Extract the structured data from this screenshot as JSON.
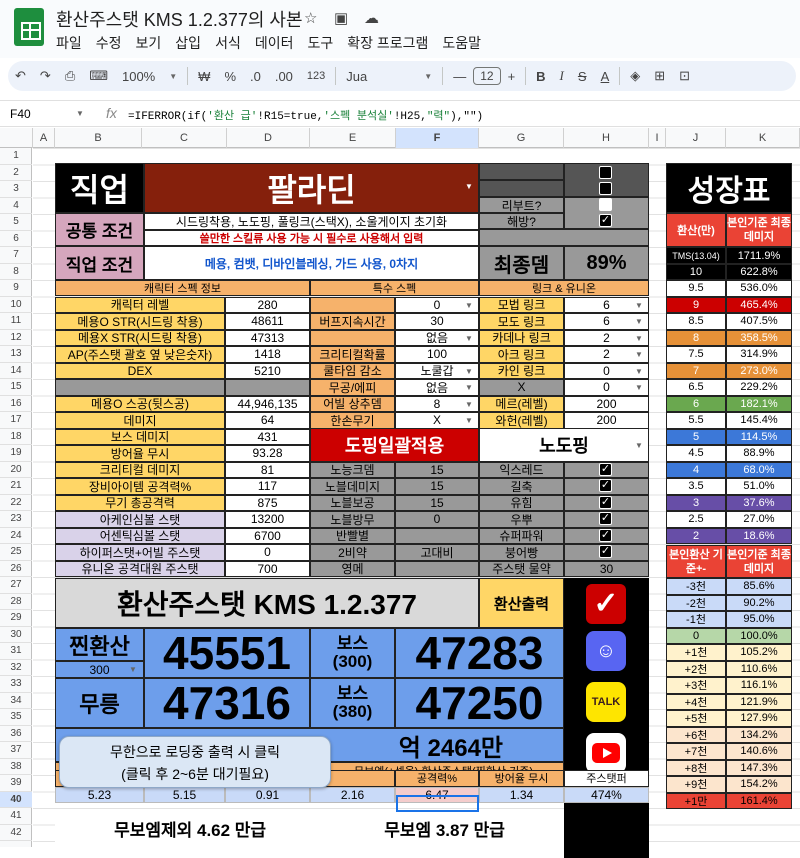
{
  "app": {
    "doc_title": "환산주스탯 KMS 1.2.377의 사본",
    "menu": [
      "파일",
      "수정",
      "보기",
      "삽입",
      "서식",
      "데이터",
      "도구",
      "확장 프로그램",
      "도움말"
    ]
  },
  "toolbar": {
    "zoom": "100%",
    "currency": "₩",
    "percent": "%",
    "dec_less": ".0",
    "dec_more": ".00",
    "num_format": "123",
    "font": "Jua",
    "font_size": "12",
    "bold": "B",
    "italic": "I"
  },
  "formula": {
    "cell": "F40",
    "fx": "fx",
    "text_prefix": "=IFERROR(if(",
    "s1": "'환산 급'",
    "mid1": "!R15=true,",
    "s2": "'스펙 분석실'",
    "mid2": "!H25,",
    "s3": "\"력\"",
    "suffix": "),\"\")"
  },
  "cols": [
    "A",
    "B",
    "C",
    "D",
    "E",
    "F",
    "G",
    "H",
    "I",
    "J",
    "K"
  ],
  "rows": [
    "1",
    "2",
    "3",
    "4",
    "5",
    "6",
    "7",
    "8",
    "9",
    "10",
    "11",
    "12",
    "13",
    "14",
    "15",
    "16",
    "17",
    "18",
    "19",
    "20",
    "21",
    "22",
    "23",
    "24",
    "25",
    "26",
    "27",
    "28",
    "29",
    "30",
    "31",
    "32",
    "33",
    "34",
    "35",
    "36",
    "37",
    "38",
    "39",
    "40",
    "41",
    "42"
  ],
  "sheet": {
    "job_label": "직업",
    "job_value": "팔라딘",
    "reboot": "리부트?",
    "release": "해방?",
    "common_label": "공통 조건",
    "common_line1": "시드링착용, 노도핑, 풀링크(스택X), 소울게이지 초기화",
    "common_line2": "쓸만한 스킬류 사용  가능 시 필수로 사용해서 입력",
    "job_cond_label": "직업 조건",
    "job_cond_value": "메용, 컴뱃, 디바인블레싱, 가드 사용, 0차지",
    "final_label": "최종뎀",
    "final_value": "89%",
    "char_spec_header": "캐릭터 스펙 정보",
    "special_header": "특수 스펙",
    "link_header": "링크 & 유니온",
    "char_rows": [
      [
        "캐릭터 레벨",
        "280"
      ],
      [
        "메용O STR(시드링 착용)",
        "48611"
      ],
      [
        "메용X STR(시드링 착용)",
        "47313"
      ],
      [
        "AP(주스탯 괄호 옆 낮은숫자)",
        "1418"
      ],
      [
        "DEX",
        "5210"
      ],
      [
        "",
        ""
      ],
      [
        "메용O 스공(뒷스공)",
        "44,946,135"
      ],
      [
        "데미지",
        "64"
      ],
      [
        "보스 데미지",
        "431"
      ],
      [
        "방어율 무시",
        "93.28"
      ],
      [
        "크리티컬 데미지",
        "81"
      ],
      [
        "장비아이템 공격력%",
        "117"
      ],
      [
        "무기 총공격력",
        "875"
      ],
      [
        "아케인심볼 스탯",
        "13200"
      ],
      [
        "어센틱심볼 스탯",
        "6700"
      ],
      [
        "하이퍼스탯+어빌 주스탯",
        "0"
      ],
      [
        "유니온 공격대원 주스탯",
        "700"
      ]
    ],
    "special_rows": [
      [
        "",
        "0"
      ],
      [
        "버프지속시간",
        "30"
      ],
      [
        "",
        "없음"
      ],
      [
        "크리티컬확률",
        "100"
      ],
      [
        "쿨타임 감소",
        "노쿨갑"
      ],
      [
        "무공/에피",
        "없음"
      ],
      [
        "어빌 상추뎀",
        "8"
      ],
      [
        "한손무기",
        "X"
      ]
    ],
    "link_rows": [
      [
        "모법 링크",
        "6"
      ],
      [
        "모도 링크",
        "6"
      ],
      [
        "카데나 링크",
        "2"
      ],
      [
        "아크 링크",
        "2"
      ],
      [
        "카인 링크",
        "0"
      ],
      [
        "X",
        "0"
      ],
      [
        "메르(레벨)",
        "200"
      ],
      [
        "와헌(레벨)",
        "200"
      ]
    ],
    "doping_btn": "도핑일괄적용",
    "doping_value": "노도핑",
    "doping_rows": [
      [
        "노능크뎀",
        "15",
        "익스레드"
      ],
      [
        "노블데미지",
        "15",
        "길축"
      ],
      [
        "노블보공",
        "15",
        "유힘"
      ],
      [
        "노블방무",
        "0",
        "우뿌"
      ],
      [
        "반빨별",
        "",
        "슈퍼파워"
      ],
      [
        "2비약",
        "고대비",
        "붕어빵"
      ],
      [
        "영메",
        "",
        "주스탯 물약"
      ]
    ],
    "potion_value": "30",
    "main_title": "환산주스탯 KMS 1.2.377",
    "output_btn": "환산출력",
    "real_label": "찐환산",
    "real_sub": "300",
    "real_value": "45551",
    "boss300_label": "보스",
    "boss300_sub": "(300)",
    "boss300_value": "47283",
    "murung_label": "무릉",
    "murung_value": "47316",
    "boss380_label": "보스",
    "boss380_sub": "(380)",
    "boss380_value": "47250",
    "tooltip_line1": "무한으로 로딩중 출력 시 클릭",
    "tooltip_line2": "(클릭 후 2~6분 대기필요)",
    "eok_text": "억 2464만",
    "bottom_header1": "무보엠(+셋옵) 환산주스탯(찐환산 기준)",
    "bottom_headers": [
      "",
      "",
      "",
      "",
      "공격력%",
      "방어율 무시",
      "주스탯퍼"
    ],
    "bottom_values": [
      "5.23",
      "5.15",
      "0.91",
      "2.16",
      "6.47",
      "1.34",
      "474%"
    ],
    "no_emblem": "무보엠제외 4.62 만급",
    "emblem": "무보엠 3.87 만급",
    "growth_title": "성장표",
    "growth_h1": "환산(만)",
    "growth_h2": "본인기준 최종데미지",
    "tms": "TMS(13.04)",
    "tms_value": "1711.9%",
    "growth_rows": [
      [
        "10",
        "622.8%"
      ],
      [
        "9.5",
        "536.0%"
      ],
      [
        "9",
        "465.4%"
      ],
      [
        "8.5",
        "407.5%"
      ],
      [
        "8",
        "358.5%"
      ],
      [
        "7.5",
        "314.9%"
      ],
      [
        "7",
        "273.0%"
      ],
      [
        "6.5",
        "229.2%"
      ],
      [
        "6",
        "182.1%"
      ],
      [
        "5.5",
        "145.4%"
      ],
      [
        "5",
        "114.5%"
      ],
      [
        "4.5",
        "88.9%"
      ],
      [
        "4",
        "68.0%"
      ],
      [
        "3.5",
        "51.0%"
      ],
      [
        "3",
        "37.6%"
      ],
      [
        "2.5",
        "27.0%"
      ],
      [
        "2",
        "18.6%"
      ]
    ],
    "rel_h1": "본인환산 기준+-",
    "rel_h2": "본인기준 최종데미지",
    "rel_rows": [
      [
        "-3천",
        "85.6%"
      ],
      [
        "-2천",
        "90.2%"
      ],
      [
        "-1천",
        "95.0%"
      ],
      [
        "0",
        "100.0%"
      ],
      [
        "+1천",
        "105.2%"
      ],
      [
        "+2천",
        "110.6%"
      ],
      [
        "+3천",
        "116.1%"
      ],
      [
        "+4천",
        "121.9%"
      ],
      [
        "+5천",
        "127.9%"
      ],
      [
        "+6천",
        "134.2%"
      ],
      [
        "+7천",
        "140.6%"
      ],
      [
        "+8천",
        "147.3%"
      ],
      [
        "+9천",
        "154.2%"
      ],
      [
        "+1만",
        "161.4%"
      ]
    ]
  },
  "colors": {
    "yellow": "#ffd666",
    "blue": "#6d9eeb",
    "orange": "#f6b26b",
    "maroon": "#85200c",
    "red": "#cc0000"
  }
}
